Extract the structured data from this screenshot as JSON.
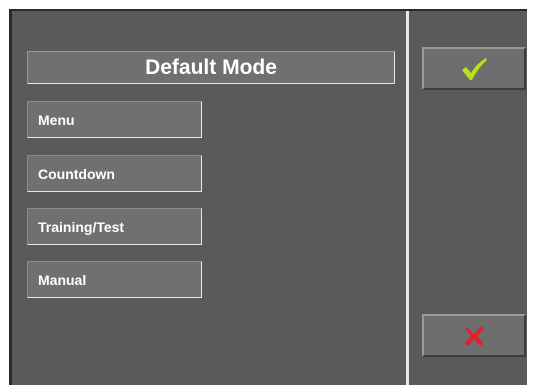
{
  "title": "Default Mode",
  "modes": [
    {
      "label": "Menu"
    },
    {
      "label": "Countdown"
    },
    {
      "label": "Training/Test"
    },
    {
      "label": "Manual"
    }
  ],
  "confirm": {
    "icon": "checkmark-icon",
    "color": "#b8e21c"
  },
  "cancel": {
    "icon": "close-x-icon",
    "color": "#e3202a"
  }
}
